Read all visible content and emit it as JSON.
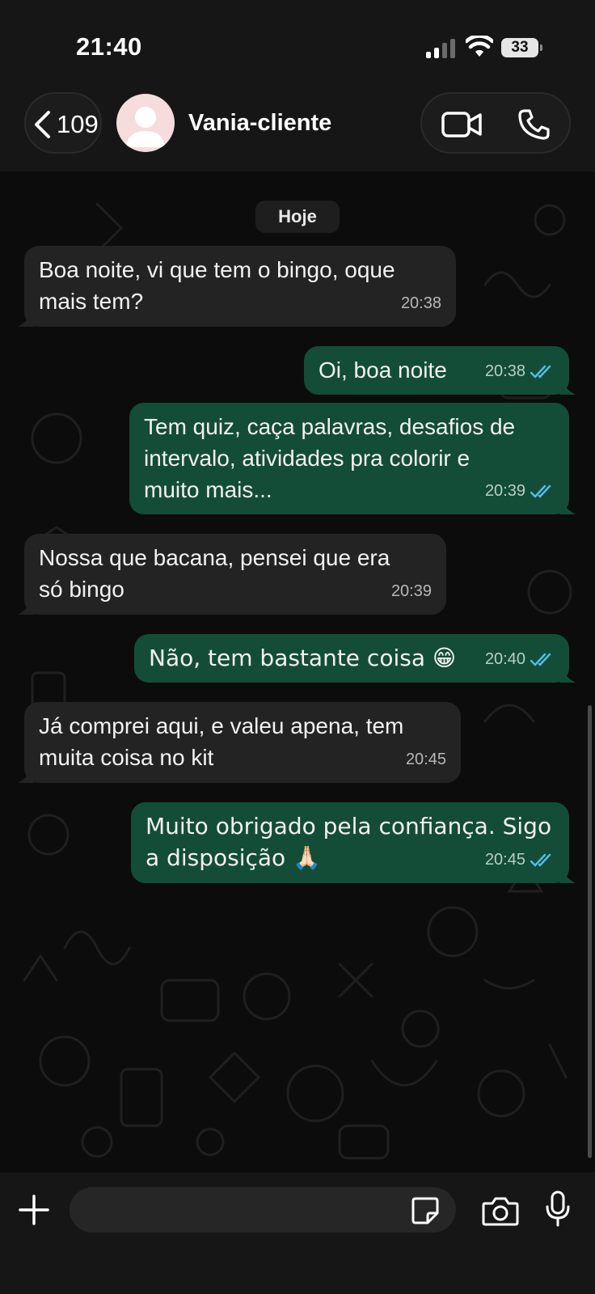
{
  "status_bar": {
    "time": "21:40",
    "battery": "33"
  },
  "header": {
    "back_count": "109",
    "contact_name": "Vania-cliente"
  },
  "chat": {
    "date_label": "Hoje",
    "messages": [
      {
        "direction": "in",
        "text": "Boa noite, vi que tem o bingo, oque\nmais tem?",
        "time": "20:38"
      },
      {
        "direction": "out",
        "text": "Oi, boa noite",
        "time": "20:38",
        "status": "read"
      },
      {
        "direction": "out",
        "text": "Tem quiz, caça palavras, desafios de\nintervalo, atividades pra colorir e\nmuito mais...",
        "time": "20:39",
        "status": "read"
      },
      {
        "direction": "in",
        "text": "Nossa que bacana, pensei que era\nsó bingo",
        "time": "20:39"
      },
      {
        "direction": "out",
        "text": "Não, tem bastante coisa 😁",
        "time": "20:40",
        "status": "read"
      },
      {
        "direction": "in",
        "text": "Já comprei aqui, e valeu apena, tem\nmuita coisa no kit",
        "time": "20:45"
      },
      {
        "direction": "out",
        "text": "Muito obrigado pela confiança. Sigo\na disposição 🙏🏻",
        "time": "20:45",
        "status": "read"
      }
    ]
  },
  "input": {
    "value": "",
    "placeholder": ""
  },
  "icons": {
    "back": "chevron-left-icon",
    "video": "video-camera-icon",
    "phone": "phone-icon",
    "plus": "plus-icon",
    "sticker": "sticker-icon",
    "camera": "camera-icon",
    "mic": "microphone-icon"
  },
  "colors": {
    "incoming_bubble": "#232323",
    "outgoing_bubble": "#134d37",
    "read_ticks": "#53bdeb"
  }
}
